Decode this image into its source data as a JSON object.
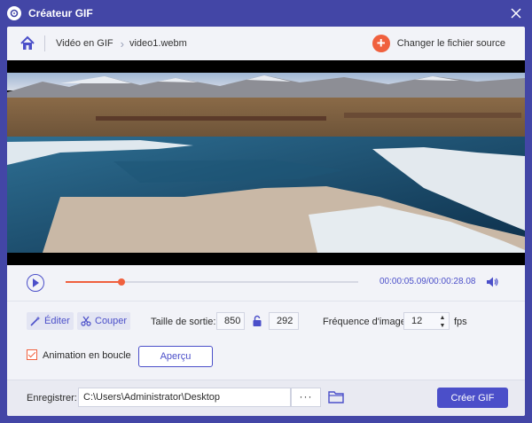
{
  "window": {
    "title": "Créateur GIF"
  },
  "breadcrumb": {
    "items": [
      "Vidéo en GIF",
      "video1.webm"
    ]
  },
  "header": {
    "change_source_label": "Changer le fichier source"
  },
  "player": {
    "current_time": "00:00:05.09",
    "separator": "/",
    "total_time": "00:00:28.08",
    "progress": 0.19
  },
  "tools": {
    "edit_label": "Éditer",
    "cut_label": "Couper"
  },
  "output": {
    "size_label": "Taille de sortie:",
    "width": "850",
    "height": "292",
    "fps_label": "Fréquence d'image:",
    "fps_value": "12",
    "fps_unit": "fps"
  },
  "loop": {
    "label": "Animation en boucle",
    "checked": true
  },
  "preview_label": "Aperçu",
  "footer": {
    "save_label": "Enregistrer:",
    "path": "C:\\Users\\Administrator\\Desktop",
    "browse_label": "···",
    "create_label": "Créer GIF"
  },
  "colors": {
    "accent": "#4b4fc9",
    "orange": "#f0603e",
    "frame": "#4346a6"
  }
}
